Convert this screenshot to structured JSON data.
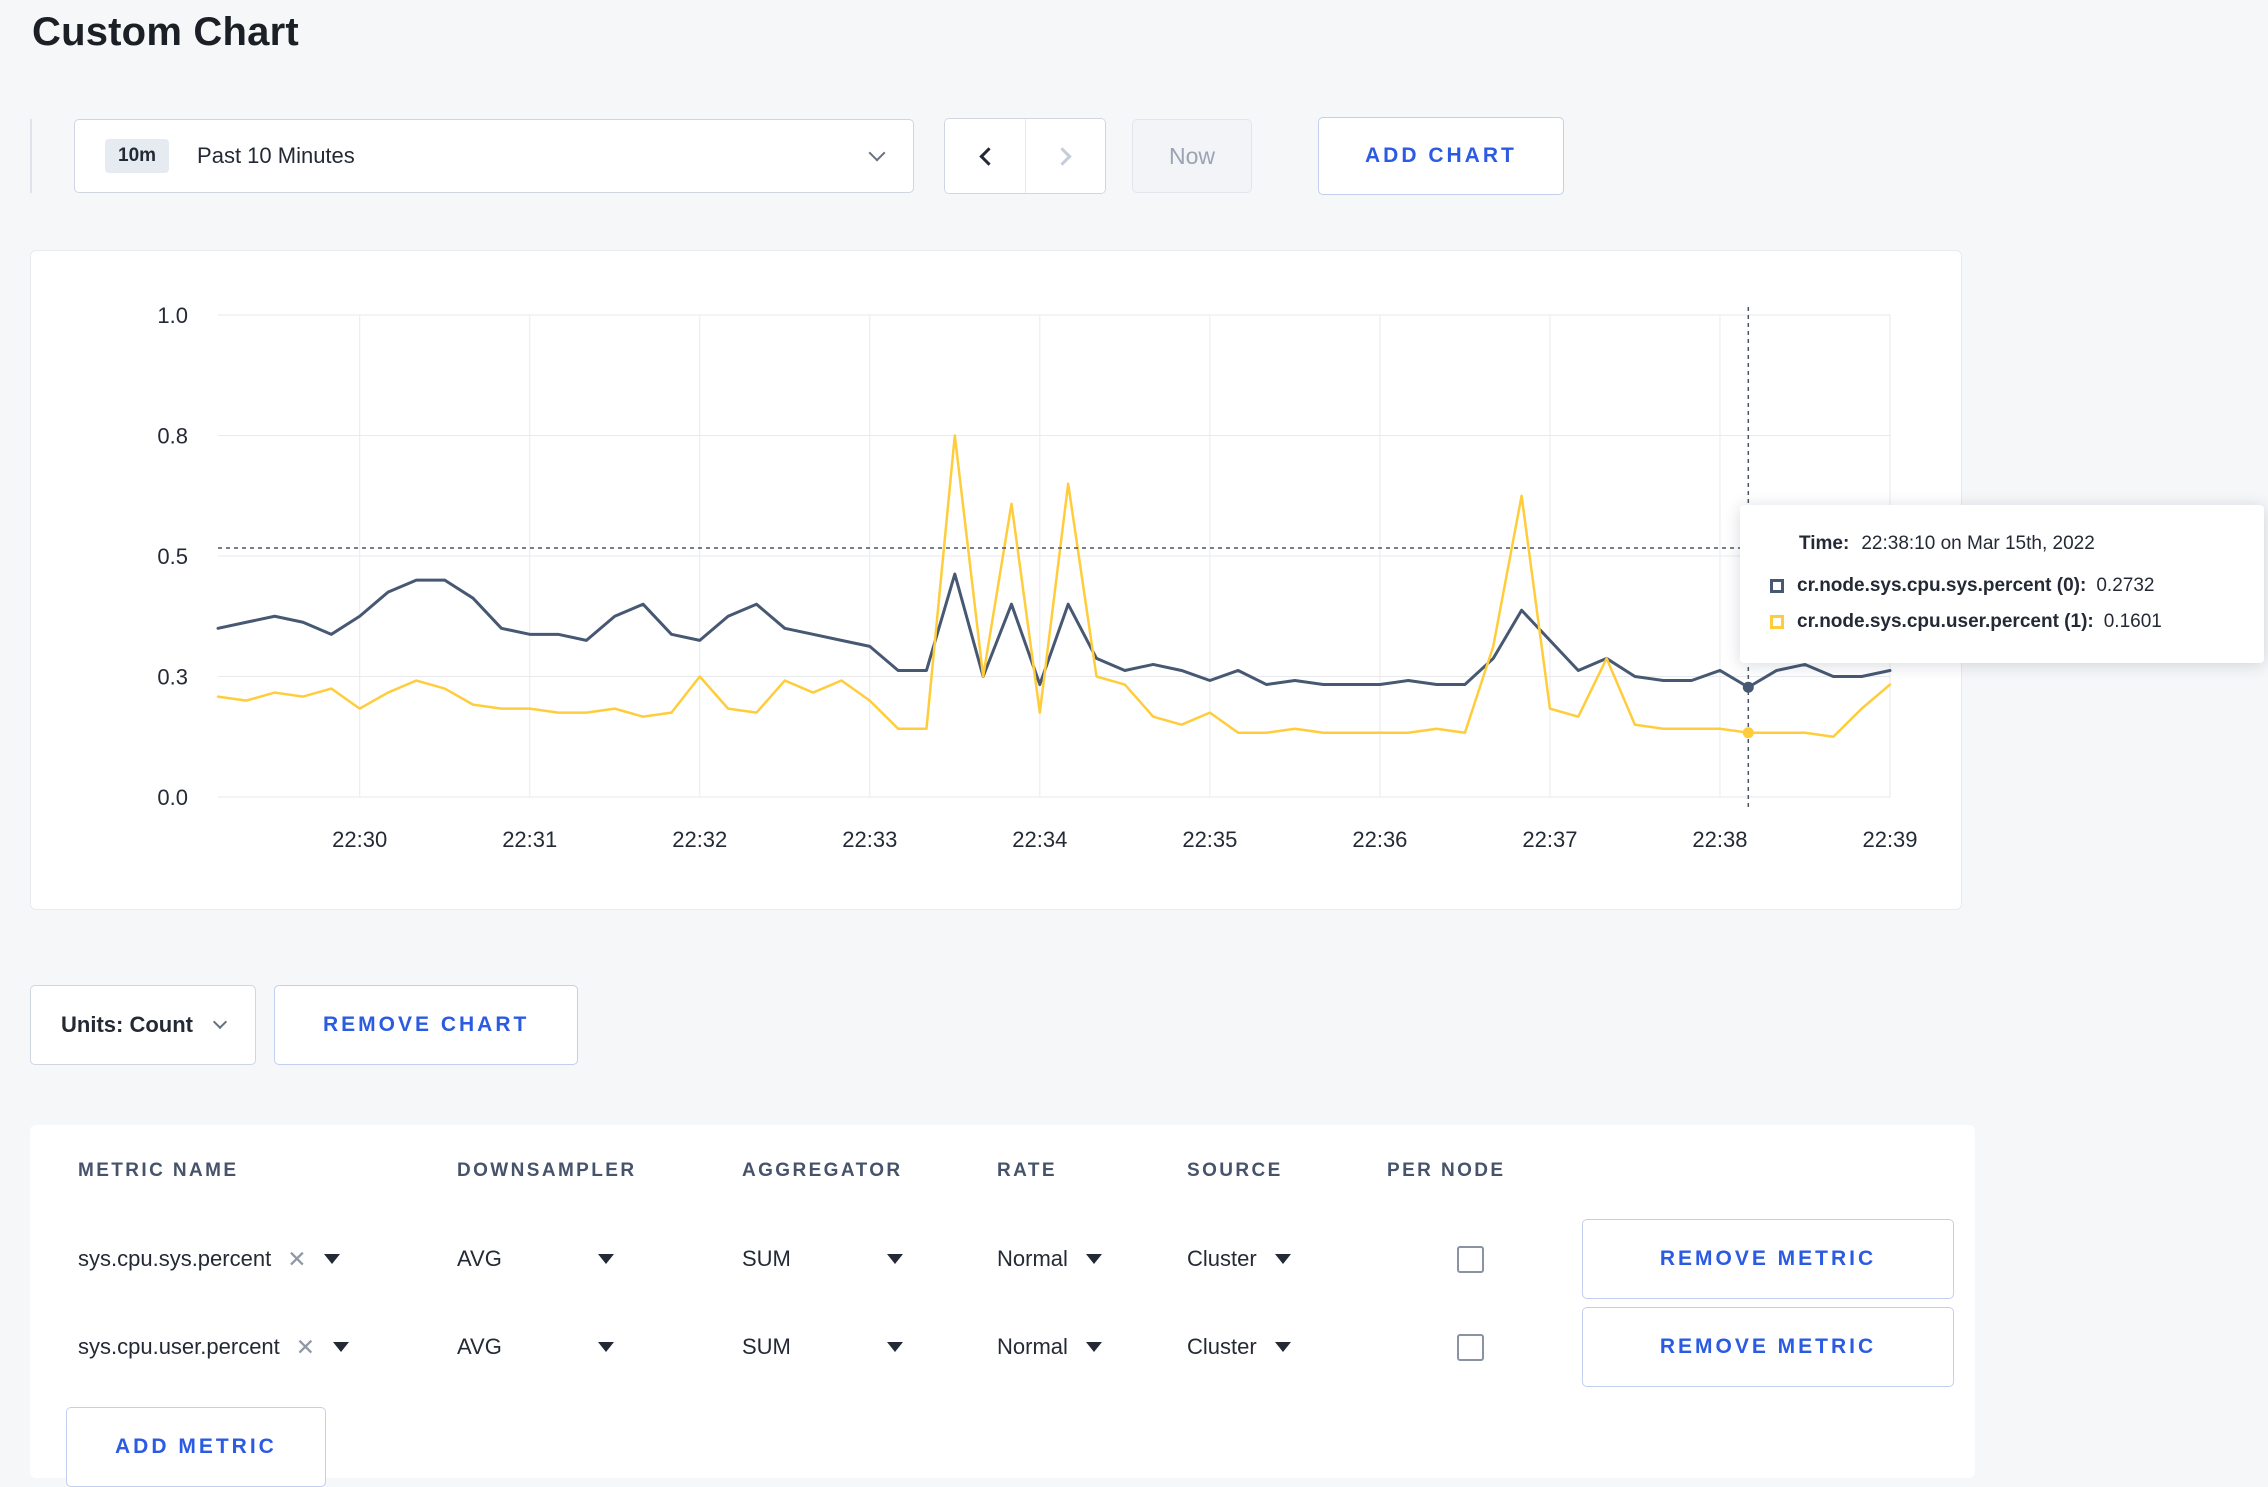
{
  "page": {
    "title": "Custom Chart"
  },
  "colors": {
    "accent_blue": "#2b5be2",
    "series_sys": "#475872",
    "series_user": "#ffcd3c"
  },
  "toolbar": {
    "range_badge": "10m",
    "range_label": "Past 10 Minutes",
    "now_label": "Now",
    "add_chart_label": "ADD CHART"
  },
  "tooltip": {
    "time_label": "Time:",
    "time_value": "22:38:10 on Mar 15th, 2022",
    "series": [
      {
        "name": "cr.node.sys.cpu.sys.percent (0):",
        "value": "0.2732"
      },
      {
        "name": "cr.node.sys.cpu.user.percent (1):",
        "value": "0.1601"
      }
    ]
  },
  "chart_data": {
    "type": "line",
    "title": "",
    "xlabel": "",
    "ylabel": "",
    "ylim": [
      0,
      1
    ],
    "grid": true,
    "x_ticks": [
      "22:30",
      "22:31",
      "22:32",
      "22:33",
      "22:34",
      "22:35",
      "22:36",
      "22:37",
      "22:38",
      "22:39"
    ],
    "x_tick_data_indices": [
      5,
      11,
      17,
      23,
      29,
      35,
      41,
      47,
      53,
      59
    ],
    "y_ticks": [
      1.0,
      0.8,
      0.5,
      0.3,
      0.0
    ],
    "series": [
      {
        "name": "cr.node.sys.cpu.sys.percent",
        "color": "#475872",
        "width": 3,
        "values": [
          0.38,
          0.39,
          0.4,
          0.39,
          0.37,
          0.4,
          0.44,
          0.46,
          0.46,
          0.43,
          0.38,
          0.37,
          0.37,
          0.36,
          0.4,
          0.42,
          0.37,
          0.36,
          0.4,
          0.42,
          0.38,
          0.37,
          0.36,
          0.35,
          0.31,
          0.31,
          0.47,
          0.3,
          0.42,
          0.28,
          0.42,
          0.33,
          0.31,
          0.32,
          0.31,
          0.29,
          0.31,
          0.28,
          0.29,
          0.28,
          0.28,
          0.28,
          0.29,
          0.28,
          0.28,
          0.33,
          0.41,
          0.36,
          0.31,
          0.33,
          0.3,
          0.29,
          0.29,
          0.31,
          0.2732,
          0.31,
          0.32,
          0.3,
          0.3,
          0.31
        ]
      },
      {
        "name": "cr.node.sys.cpu.user.percent",
        "color": "#ffcd3c",
        "width": 2.5,
        "values": [
          0.25,
          0.24,
          0.26,
          0.25,
          0.27,
          0.22,
          0.26,
          0.29,
          0.27,
          0.23,
          0.22,
          0.22,
          0.21,
          0.21,
          0.22,
          0.2,
          0.21,
          0.3,
          0.22,
          0.21,
          0.29,
          0.26,
          0.29,
          0.24,
          0.17,
          0.17,
          0.8,
          0.3,
          0.63,
          0.21,
          0.68,
          0.3,
          0.28,
          0.2,
          0.18,
          0.21,
          0.16,
          0.16,
          0.17,
          0.16,
          0.16,
          0.16,
          0.16,
          0.17,
          0.16,
          0.35,
          0.65,
          0.22,
          0.2,
          0.33,
          0.18,
          0.17,
          0.17,
          0.17,
          0.1601,
          0.16,
          0.16,
          0.15,
          0.22,
          0.28
        ]
      }
    ],
    "crosshair": {
      "data_index": 54,
      "time": "22:38:10",
      "h_line_value": 0.52
    }
  },
  "chart_footer": {
    "units_label": "Units: Count",
    "remove_chart_label": "REMOVE CHART"
  },
  "metrics_table": {
    "headers": [
      "METRIC NAME",
      "DOWNSAMPLER",
      "AGGREGATOR",
      "RATE",
      "SOURCE",
      "PER NODE"
    ],
    "rows": [
      {
        "metric": "sys.cpu.sys.percent",
        "downsampler": "AVG",
        "aggregator": "SUM",
        "rate": "Normal",
        "source": "Cluster",
        "per_node_checked": false,
        "remove_label": "REMOVE METRIC"
      },
      {
        "metric": "sys.cpu.user.percent",
        "downsampler": "AVG",
        "aggregator": "SUM",
        "rate": "Normal",
        "source": "Cluster",
        "per_node_checked": false,
        "remove_label": "REMOVE METRIC"
      }
    ],
    "add_metric_label": "ADD METRIC"
  }
}
